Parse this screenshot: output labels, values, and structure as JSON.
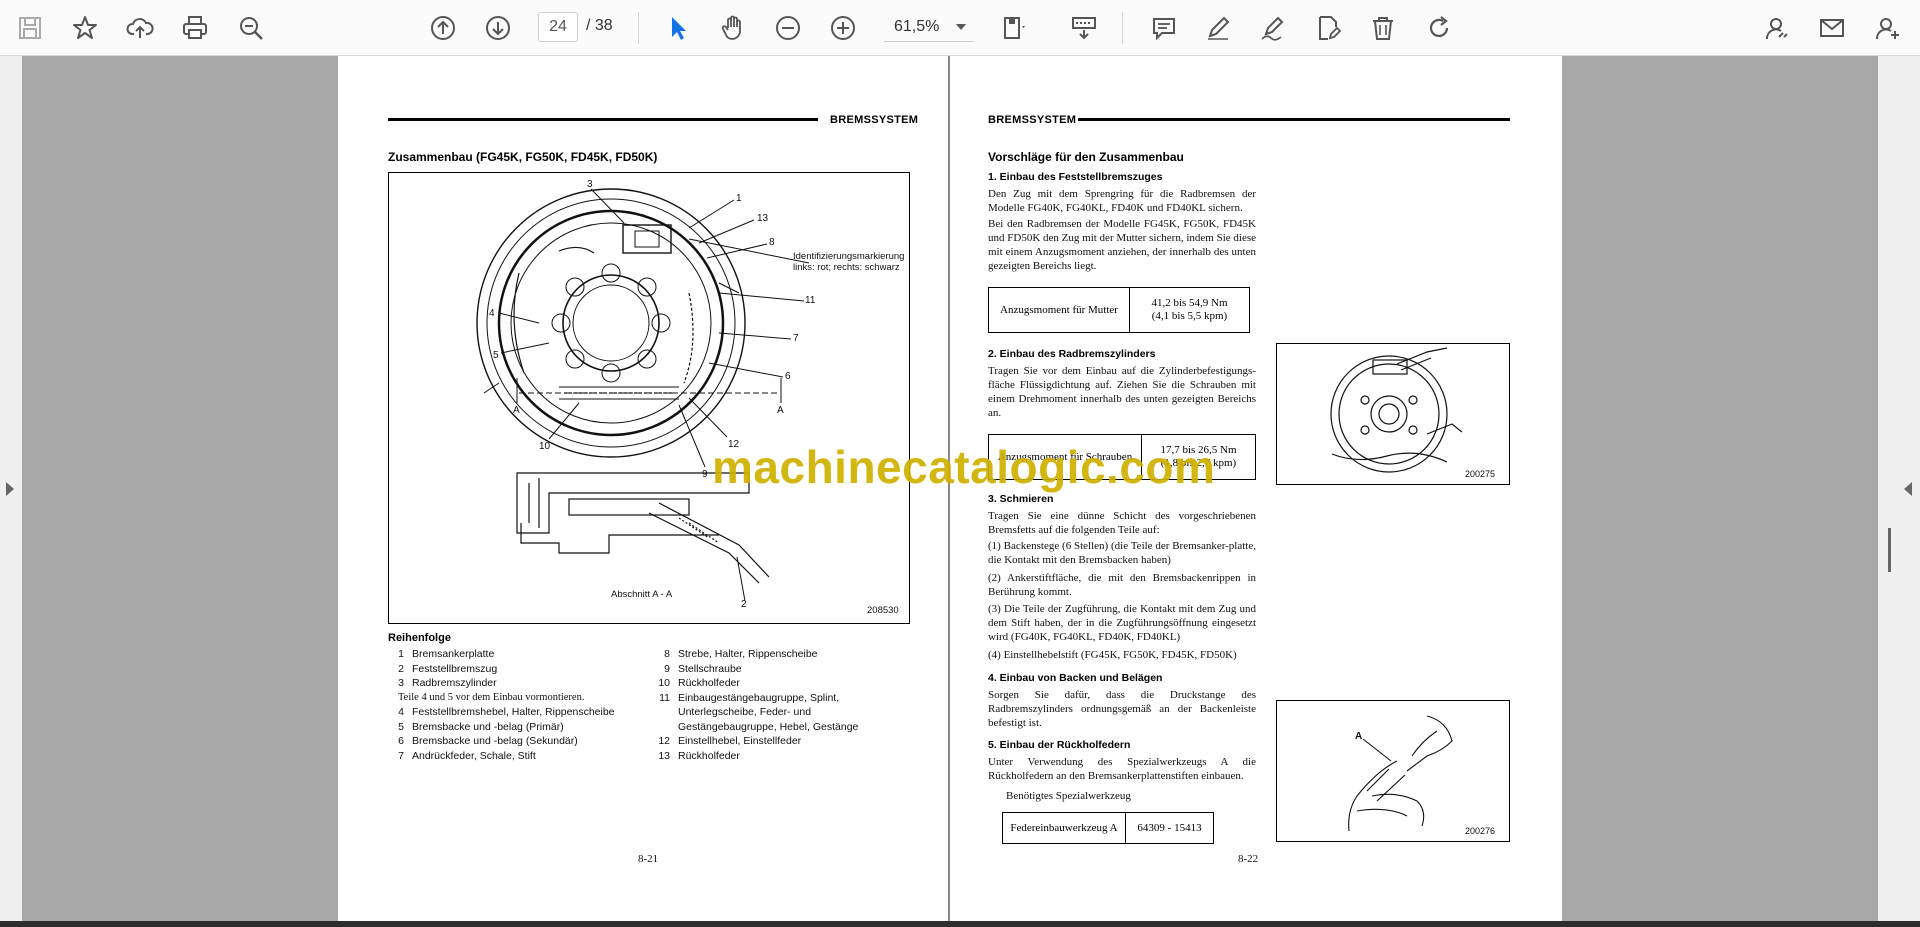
{
  "toolbar": {
    "page_current": "24",
    "page_total": "/ 38",
    "zoom": "61,5%",
    "icons": [
      "save-icon",
      "bookmark-star-icon",
      "upload-cloud-icon",
      "print-icon",
      "zoom-search-icon",
      "page-up-icon",
      "page-down-icon",
      "select-pointer-icon",
      "hand-pan-icon",
      "zoom-out-icon",
      "zoom-in-icon",
      "page-fit-icon",
      "scroll-mode-icon",
      "comment-icon",
      "pen-icon",
      "sign-icon",
      "edit-pdf-icon",
      "delete-icon",
      "rotate-icon",
      "share-link-icon",
      "mail-icon",
      "add-user-icon"
    ],
    "accent_color": "#1473e6"
  },
  "left_page": {
    "header": "BREMSSYSTEM",
    "title": "Zusammenbau (FG45K, FG50K, FD45K, FD50K)",
    "figure": {
      "callouts": [
        "3",
        "1",
        "13",
        "8",
        "11",
        "7",
        "6",
        "12",
        "9",
        "10",
        "4",
        "5",
        "A",
        "A",
        "2"
      ],
      "annotation_line1": "Identifizierungsmarkierung",
      "annotation_line2": "links: rot; rechts: schwarz",
      "section_label": "Abschnitt A - A",
      "fig_number": "208530"
    },
    "legend_title": "Reihenfolge",
    "legend_left": [
      {
        "n": "1",
        "t": "Bremsankerplatte"
      },
      {
        "n": "2",
        "t": "Feststellbremszug"
      },
      {
        "n": "3",
        "t": "Radbremszylinder"
      }
    ],
    "note": "Teile 4 und 5 vor dem Einbau vormontieren.",
    "legend_left2": [
      {
        "n": "4",
        "t": "Feststellbremshebel, Halter, Rippenscheibe"
      },
      {
        "n": "5",
        "t": "Bremsbacke und -belag (Primär)"
      },
      {
        "n": "6",
        "t": "Bremsbacke und -belag (Sekundär)"
      },
      {
        "n": "7",
        "t": "Andrückfeder, Schale, Stift"
      }
    ],
    "legend_right": [
      {
        "n": "8",
        "t": "Strebe, Halter, Rippenscheibe"
      },
      {
        "n": "9",
        "t": "Stellschraube"
      },
      {
        "n": "10",
        "t": "Rückholfeder"
      },
      {
        "n": "11",
        "t": "Einbaugestängebaugruppe, Splint,"
      },
      {
        "n": "",
        "t": "Unterlegscheibe, Feder- und"
      },
      {
        "n": "",
        "t": "Gestängebaugruppe, Hebel, Gestänge"
      },
      {
        "n": "12",
        "t": "Einstellhebel, Einstellfeder"
      },
      {
        "n": "13",
        "t": "Rückholfeder"
      }
    ],
    "page_number": "8-21"
  },
  "right_page": {
    "header": "BREMSSYSTEM",
    "title": "Vorschläge für den Zusammenbau",
    "s1_title": "1.   Einbau des Feststellbremszuges",
    "s1_p1": "Den Zug mit dem Sprengring für die Radbremsen der Modelle FG40K, FG40KL, FD40K und FD40KL sichern.",
    "s1_p2": "Bei den Radbremsen der Modelle FG45K, FG50K, FD45K und FD50K den Zug mit der Mutter sichern, indem Sie diese mit einem Anzugsmoment anziehen, der innerhalb des unten gezeigten Bereichs liegt.",
    "t1_label": "Anzugsmoment für Mutter",
    "t1_v1": "41,2 bis 54,9 Nm",
    "t1_v2": "(4,1 bis 5,5 kpm)",
    "s2_title": "2.   Einbau des Radbremszylinders",
    "s2_p": "Tragen Sie vor dem Einbau auf die Zylinderbefestigungs-fläche Flüssigdichtung auf. Ziehen Sie die Schrauben mit einem Drehmoment innerhalb des unten gezeigten Bereichs an.",
    "t2_label": "Anzugsmoment für Schrauben",
    "t2_v1": "17,7 bis 26,5 Nm",
    "t2_v2": "(1,8 bis 2,7 kpm)",
    "s3_title": "3.   Schmieren",
    "s3_p": "Tragen Sie eine dünne Schicht des vorgeschriebenen Bremsfetts auf die folgenden Teile auf:",
    "s3_items": [
      "(1)  Backenstege (6 Stellen) (die Teile der Bremsanker-platte, die Kontakt mit den Bremsbacken haben)",
      "(2)  Ankerstiftfläche, die mit den Bremsbackenrippen in Berührung kommt.",
      "(3)  Die Teile der Zugführung, die Kontakt mit dem Zug und dem Stift haben, der in die Zugführungsöffnung eingesetzt wird (FG40K, FG40KL, FD40K, FD40KL)",
      "(4)  Einstellhebelstift (FG45K, FG50K, FD45K, FD50K)"
    ],
    "s4_title": "4.   Einbau von Backen und Belägen",
    "s4_p": "Sorgen Sie dafür, dass die Druckstange des Radbremszylinders ordnungsgemäß an der Backenleiste befestigt ist.",
    "s5_title": "5.   Einbau der Rückholfedern",
    "s5_p": "Unter Verwendung des Spezialwerkzeugs A die Rückholfedern an den Bremsankerplattenstiften einbauen.",
    "s5_sub": "Benötigtes Spezialwerkzeug",
    "t3_label": "Federeinbauwerkzeug A",
    "t3_v": "64309 - 15413",
    "fig1_number": "200275",
    "fig2_label": "A",
    "fig2_number": "200276",
    "page_number": "8-22"
  },
  "watermark": "machinecatalogic.com"
}
